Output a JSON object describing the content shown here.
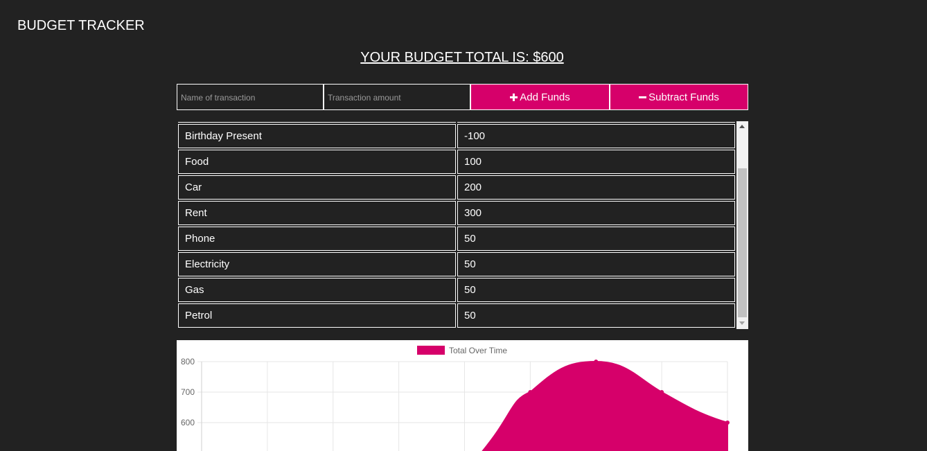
{
  "header": {
    "app_title": "BUDGET TRACKER"
  },
  "budget": {
    "total_text": "YOUR BUDGET TOTAL IS: $600"
  },
  "form": {
    "name_placeholder": "Name of transaction",
    "amount_placeholder": "Transaction amount",
    "add_label": "Add Funds",
    "subtract_label": "Subtract Funds"
  },
  "transactions": [
    {
      "name": "Birthday Present",
      "amount": "-100"
    },
    {
      "name": "Food",
      "amount": "100"
    },
    {
      "name": "Car",
      "amount": "200"
    },
    {
      "name": "Rent",
      "amount": "300"
    },
    {
      "name": "Phone",
      "amount": "50"
    },
    {
      "name": "Electricity",
      "amount": "50"
    },
    {
      "name": "Gas",
      "amount": "50"
    },
    {
      "name": "Petrol",
      "amount": "50"
    }
  ],
  "colors": {
    "accent": "#d6006a",
    "background": "#222222"
  },
  "icons": {
    "add": "plus-icon",
    "subtract": "minus-icon"
  },
  "chart_data": {
    "type": "area",
    "legend_position": "top",
    "series": [
      {
        "name": "Total Over Time",
        "values": [
          null,
          null,
          null,
          null,
          null,
          700,
          800,
          700,
          600
        ]
      }
    ],
    "yticks": [
      800,
      700,
      600
    ],
    "ylim_visible": [
      560,
      800
    ],
    "grid": true,
    "color": "#d6006a"
  }
}
